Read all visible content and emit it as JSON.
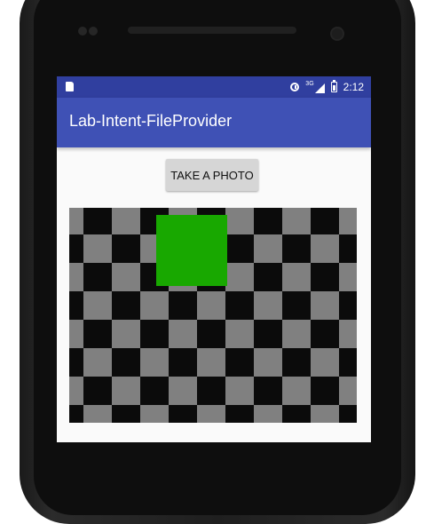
{
  "status_bar": {
    "time": "2:12",
    "network": "3G",
    "icons": [
      "sd-card-icon",
      "alarm-icon",
      "signal-icon",
      "battery-icon"
    ]
  },
  "app_bar": {
    "title": "Lab-Intent-FileProvider"
  },
  "main": {
    "take_photo_label": "TAKE A PHOTO",
    "photo": {
      "description_colors": {
        "dark": "#0b0b0b",
        "light": "#808080",
        "accent": "#18a800"
      }
    }
  },
  "colors": {
    "status_bar": "#303f9f",
    "app_bar": "#3f51b5",
    "button": "#d6d6d6",
    "background": "#fafafa"
  }
}
